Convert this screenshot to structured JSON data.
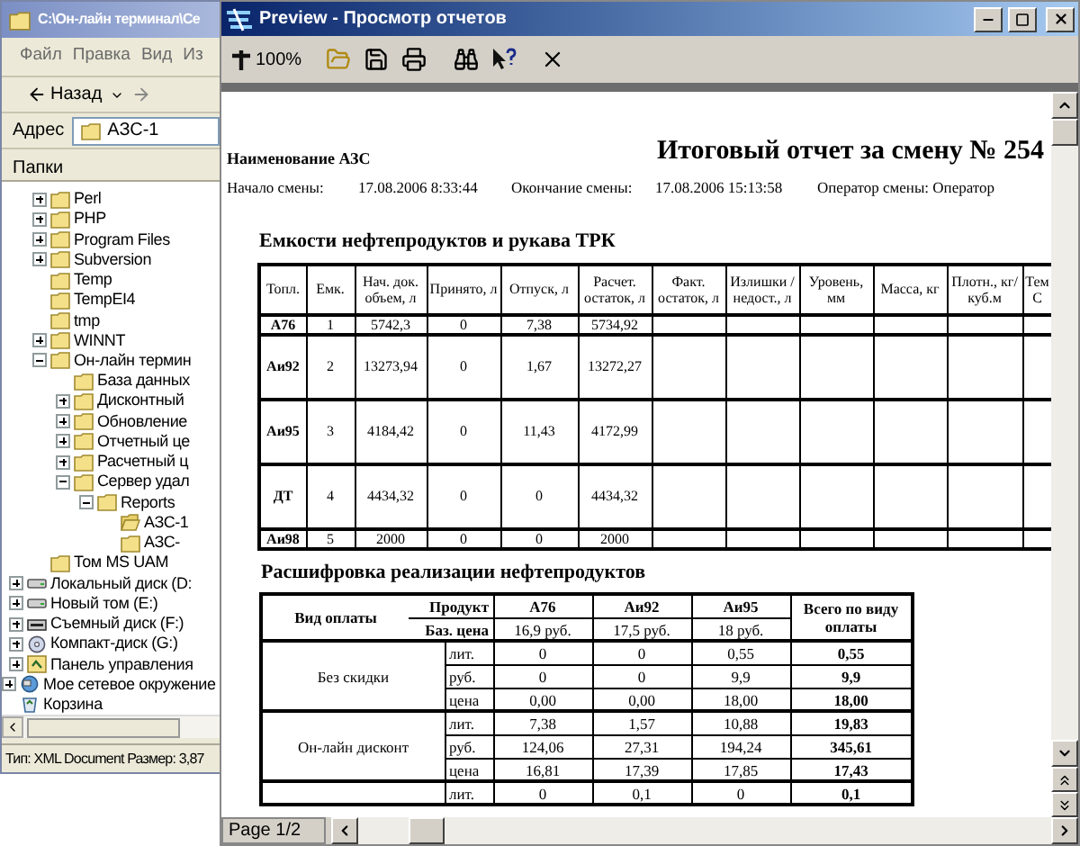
{
  "explorer": {
    "title": "C:\\Он-лайн терминал\\Се",
    "menu": [
      "Файл",
      "Правка",
      "Вид",
      "Из"
    ],
    "back_button": "Назад",
    "address_label": "Адрес",
    "address_value": "АЗС-1",
    "folders_header": "Папки",
    "tree": [
      {
        "children": [
          {
            "children": [
              {
                "label": "Perl",
                "kind": "folder",
                "expandable": true,
                "expanded": false
              },
              {
                "label": "PHP",
                "kind": "folder",
                "expandable": true,
                "expanded": false
              },
              {
                "label": "Program Files",
                "kind": "folder",
                "expandable": true,
                "expanded": false
              },
              {
                "label": "Subversion",
                "kind": "folder",
                "expandable": true,
                "expanded": false
              },
              {
                "label": "Temp",
                "kind": "folder",
                "expandable": false
              },
              {
                "label": "TempEI4",
                "kind": "folder",
                "expandable": false
              },
              {
                "label": "tmp",
                "kind": "folder",
                "expandable": false
              },
              {
                "label": "WINNT",
                "kind": "folder",
                "expandable": true,
                "expanded": false
              },
              {
                "label": "Он-лайн термин",
                "kind": "folder",
                "expandable": true,
                "expanded": true,
                "children": [
                  {
                    "label": "База данных",
                    "kind": "folder",
                    "expandable": false
                  },
                  {
                    "label": "Дисконтный",
                    "kind": "folder",
                    "expandable": true,
                    "expanded": false
                  },
                  {
                    "label": "Обновление",
                    "kind": "folder",
                    "expandable": true,
                    "expanded": false
                  },
                  {
                    "label": "Отчетный це",
                    "kind": "folder",
                    "expandable": true,
                    "expanded": false
                  },
                  {
                    "label": "Расчетный ц",
                    "kind": "folder",
                    "expandable": true,
                    "expanded": false
                  },
                  {
                    "label": "Сервер удал",
                    "kind": "folder",
                    "expandable": true,
                    "expanded": true,
                    "children": [
                      {
                        "label": "Reports",
                        "kind": "folder",
                        "expandable": true,
                        "expanded": true,
                        "children": [
                          {
                            "label": "АЗС-1",
                            "kind": "open-folder",
                            "expandable": false
                          },
                          {
                            "label": "АЗС-",
                            "kind": "folder",
                            "expandable": false
                          }
                        ]
                      }
                    ]
                  }
                ]
              },
              {
                "label": "Том MS UAM",
                "kind": "folder",
                "expandable": false
              }
            ]
          },
          {
            "label": "Локальный диск (D:",
            "kind": "drive",
            "expandable": true,
            "expanded": false
          },
          {
            "label": "Новый том (E:)",
            "kind": "drive",
            "expandable": true,
            "expanded": false
          },
          {
            "label": "Съемный диск (F:)",
            "kind": "removable",
            "expandable": true,
            "expanded": false
          },
          {
            "label": "Компакт-диск (G:)",
            "kind": "cdrom",
            "expandable": true,
            "expanded": false
          },
          {
            "label": "Панель управления",
            "kind": "control-panel",
            "expandable": true,
            "expanded": false
          }
        ]
      },
      {
        "label": "Мое сетевое окружение",
        "kind": "network",
        "expandable": true,
        "expanded": false
      },
      {
        "label": "Корзина",
        "kind": "trash",
        "expandable": false
      }
    ],
    "status": "Тип: XML Document Размер: 3,87"
  },
  "preview": {
    "title": "Preview - Просмотр отчетов",
    "zoom": "100%",
    "station_label": "Наименование АЗС",
    "report_title": "Итоговый отчет за смену № 254",
    "shift_start_label": "Начало смены:",
    "shift_start": "17.08.2006 8:33:44",
    "shift_end_label": "Окончание смены:",
    "shift_end": "17.08.2006 15:13:58",
    "operator": "Оператор смены: Оператор",
    "tanks": {
      "title": "Емкости нефтепродуктов и рукава ТРК",
      "columns": [
        "Топл.",
        "Емк.",
        "Нач. док. объем, л",
        "Принято, л",
        "Отпуск, л",
        "Расчет. остаток, л",
        "Факт. остаток, л",
        "Излишки /недост., л",
        "Уровень, мм",
        "Масса, кг",
        "Плотн., кг/куб.м",
        "Тем С"
      ],
      "rows": [
        {
          "cells": [
            "А76",
            "1",
            "5742,3",
            "0",
            "7,38",
            "5734,92"
          ],
          "tall": false
        },
        {
          "cells": [
            "Аи92",
            "2",
            "13273,94",
            "0",
            "1,67",
            "13272,27"
          ],
          "tall": true
        },
        {
          "cells": [
            "Аи95",
            "3",
            "4184,42",
            "0",
            "11,43",
            "4172,99"
          ],
          "tall": true
        },
        {
          "cells": [
            "ДТ",
            "4",
            "4434,32",
            "0",
            "0",
            "4434,32"
          ],
          "tall": true
        },
        {
          "cells": [
            "Аи98",
            "5",
            "2000",
            "0",
            "0",
            "2000"
          ],
          "tall": false
        }
      ]
    },
    "sales": {
      "title": "Расшифровка реализации нефтепродуктов",
      "payment_header": "Вид оплаты",
      "product_header": "Продукт",
      "price_header": "Баз. цена",
      "products": [
        {
          "name": "А76",
          "price": "16,9 руб."
        },
        {
          "name": "Аи92",
          "price": "17,5 руб."
        },
        {
          "name": "Аи95",
          "price": "18 руб."
        }
      ],
      "total_header": "Всего по виду оплаты",
      "groups": [
        {
          "label": "Без скидки",
          "rows": [
            {
              "unit": "лит.",
              "values": [
                "0",
                "0",
                "0,55"
              ],
              "total": "0,55"
            },
            {
              "unit": "руб.",
              "values": [
                "0",
                "0",
                "9,9"
              ],
              "total": "9,9"
            },
            {
              "unit": "цена",
              "values": [
                "0,00",
                "0,00",
                "18,00"
              ],
              "total": "18,00"
            }
          ]
        },
        {
          "label": "Он-лайн дисконт",
          "rows": [
            {
              "unit": "лит.",
              "values": [
                "7,38",
                "1,57",
                "10,88"
              ],
              "total": "19,83"
            },
            {
              "unit": "руб.",
              "values": [
                "124,06",
                "27,31",
                "194,24"
              ],
              "total": "345,61"
            },
            {
              "unit": "цена",
              "values": [
                "16,81",
                "17,39",
                "17,85"
              ],
              "total": "17,43"
            }
          ]
        },
        {
          "rows": [
            {
              "unit": "лит.",
              "values": [
                "0",
                "0,1",
                "0"
              ],
              "total": "0,1"
            }
          ]
        }
      ]
    },
    "page_indicator": "Page 1/2"
  }
}
